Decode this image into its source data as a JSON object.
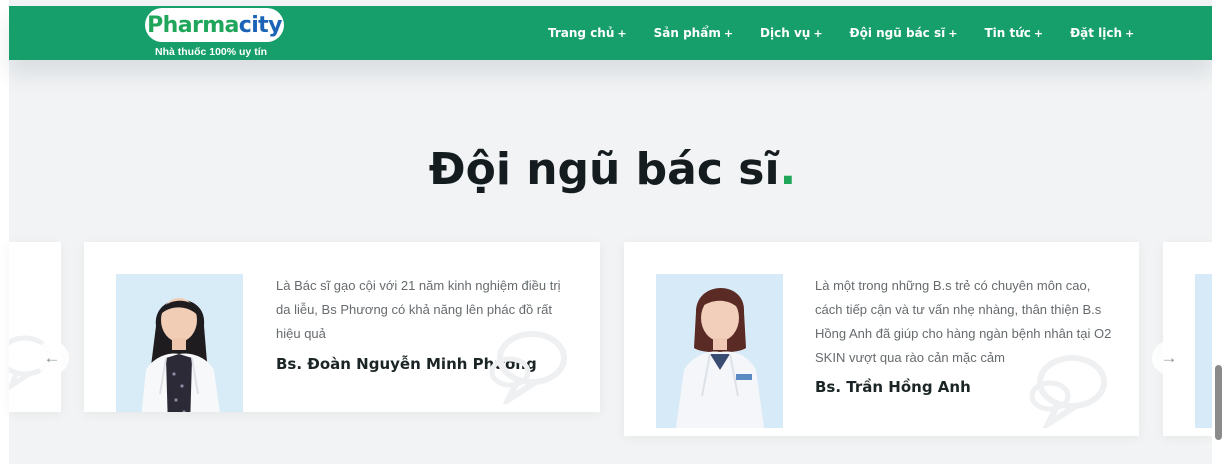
{
  "header": {
    "logo": {
      "part1": "Pharma",
      "part2": "city",
      "tagline": "Nhà thuốc 100% uy tín"
    },
    "nav": [
      {
        "label": "Trang chủ",
        "suffix": "+"
      },
      {
        "label": "Sản phẩm",
        "suffix": "+"
      },
      {
        "label": "Dịch vụ",
        "suffix": "+"
      },
      {
        "label": "Đội ngũ bác sĩ",
        "suffix": "+"
      },
      {
        "label": "Tin tức",
        "suffix": "+"
      },
      {
        "label": "Đặt lịch",
        "suffix": "+"
      }
    ],
    "bg_color": "#169e6b"
  },
  "section": {
    "title": "Đội ngũ bác sĩ",
    "title_dot": "."
  },
  "doctors": [
    {
      "quote": "Là Bác sĩ gạo cội với 21 năm kinh nghiệm điều trị da liễu, Bs Phương có khả năng lên phác đồ rất hiệu quả",
      "name": "Bs. Đoàn Nguyễn Minh Phương"
    },
    {
      "quote": "Là một trong những B.s trẻ có chuyên môn cao, cách tiếp cận và tư vấn nhẹ nhàng, thân thiện B.s Hồng Anh đã giúp cho hàng ngàn bệnh nhân tại O2 SKIN vượt qua rào cản mặc cảm",
      "name": "Bs. Trần Hồng Anh"
    }
  ],
  "carousel": {
    "prev_icon": "arrow-left-icon",
    "next_icon": "arrow-right-icon",
    "prev_glyph": "←",
    "next_glyph": "→"
  },
  "colors": {
    "accent": "#1fa65a",
    "brand_blue": "#1b63b6",
    "page_bg": "#f1f3f4",
    "card_bg": "#ffffff"
  }
}
